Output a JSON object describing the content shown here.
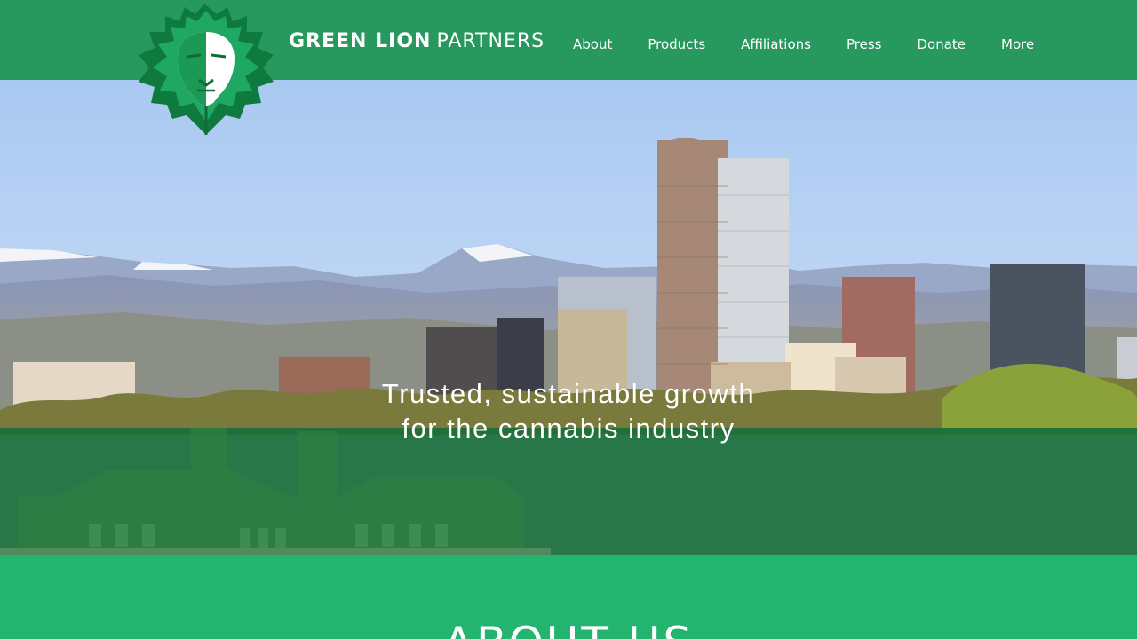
{
  "header": {
    "brand_bold": "GREEN LION",
    "brand_light": "PARTNERS",
    "nav": [
      {
        "label": "About"
      },
      {
        "label": "Products"
      },
      {
        "label": "Affiliations"
      },
      {
        "label": "Press"
      },
      {
        "label": "Donate"
      },
      {
        "label": "More"
      }
    ]
  },
  "hero": {
    "tagline_line1": "Trusted, sustainable growth",
    "tagline_line2": "for the cannabis industry"
  },
  "about": {
    "title": "ABOUT US"
  },
  "colors": {
    "header_bg": "#27985e",
    "brand_green": "#23b46f",
    "dark_green": "#0f6b37",
    "band_green": "#1a6e3a"
  },
  "icons": {
    "logo": "lion-head-logo-icon"
  }
}
